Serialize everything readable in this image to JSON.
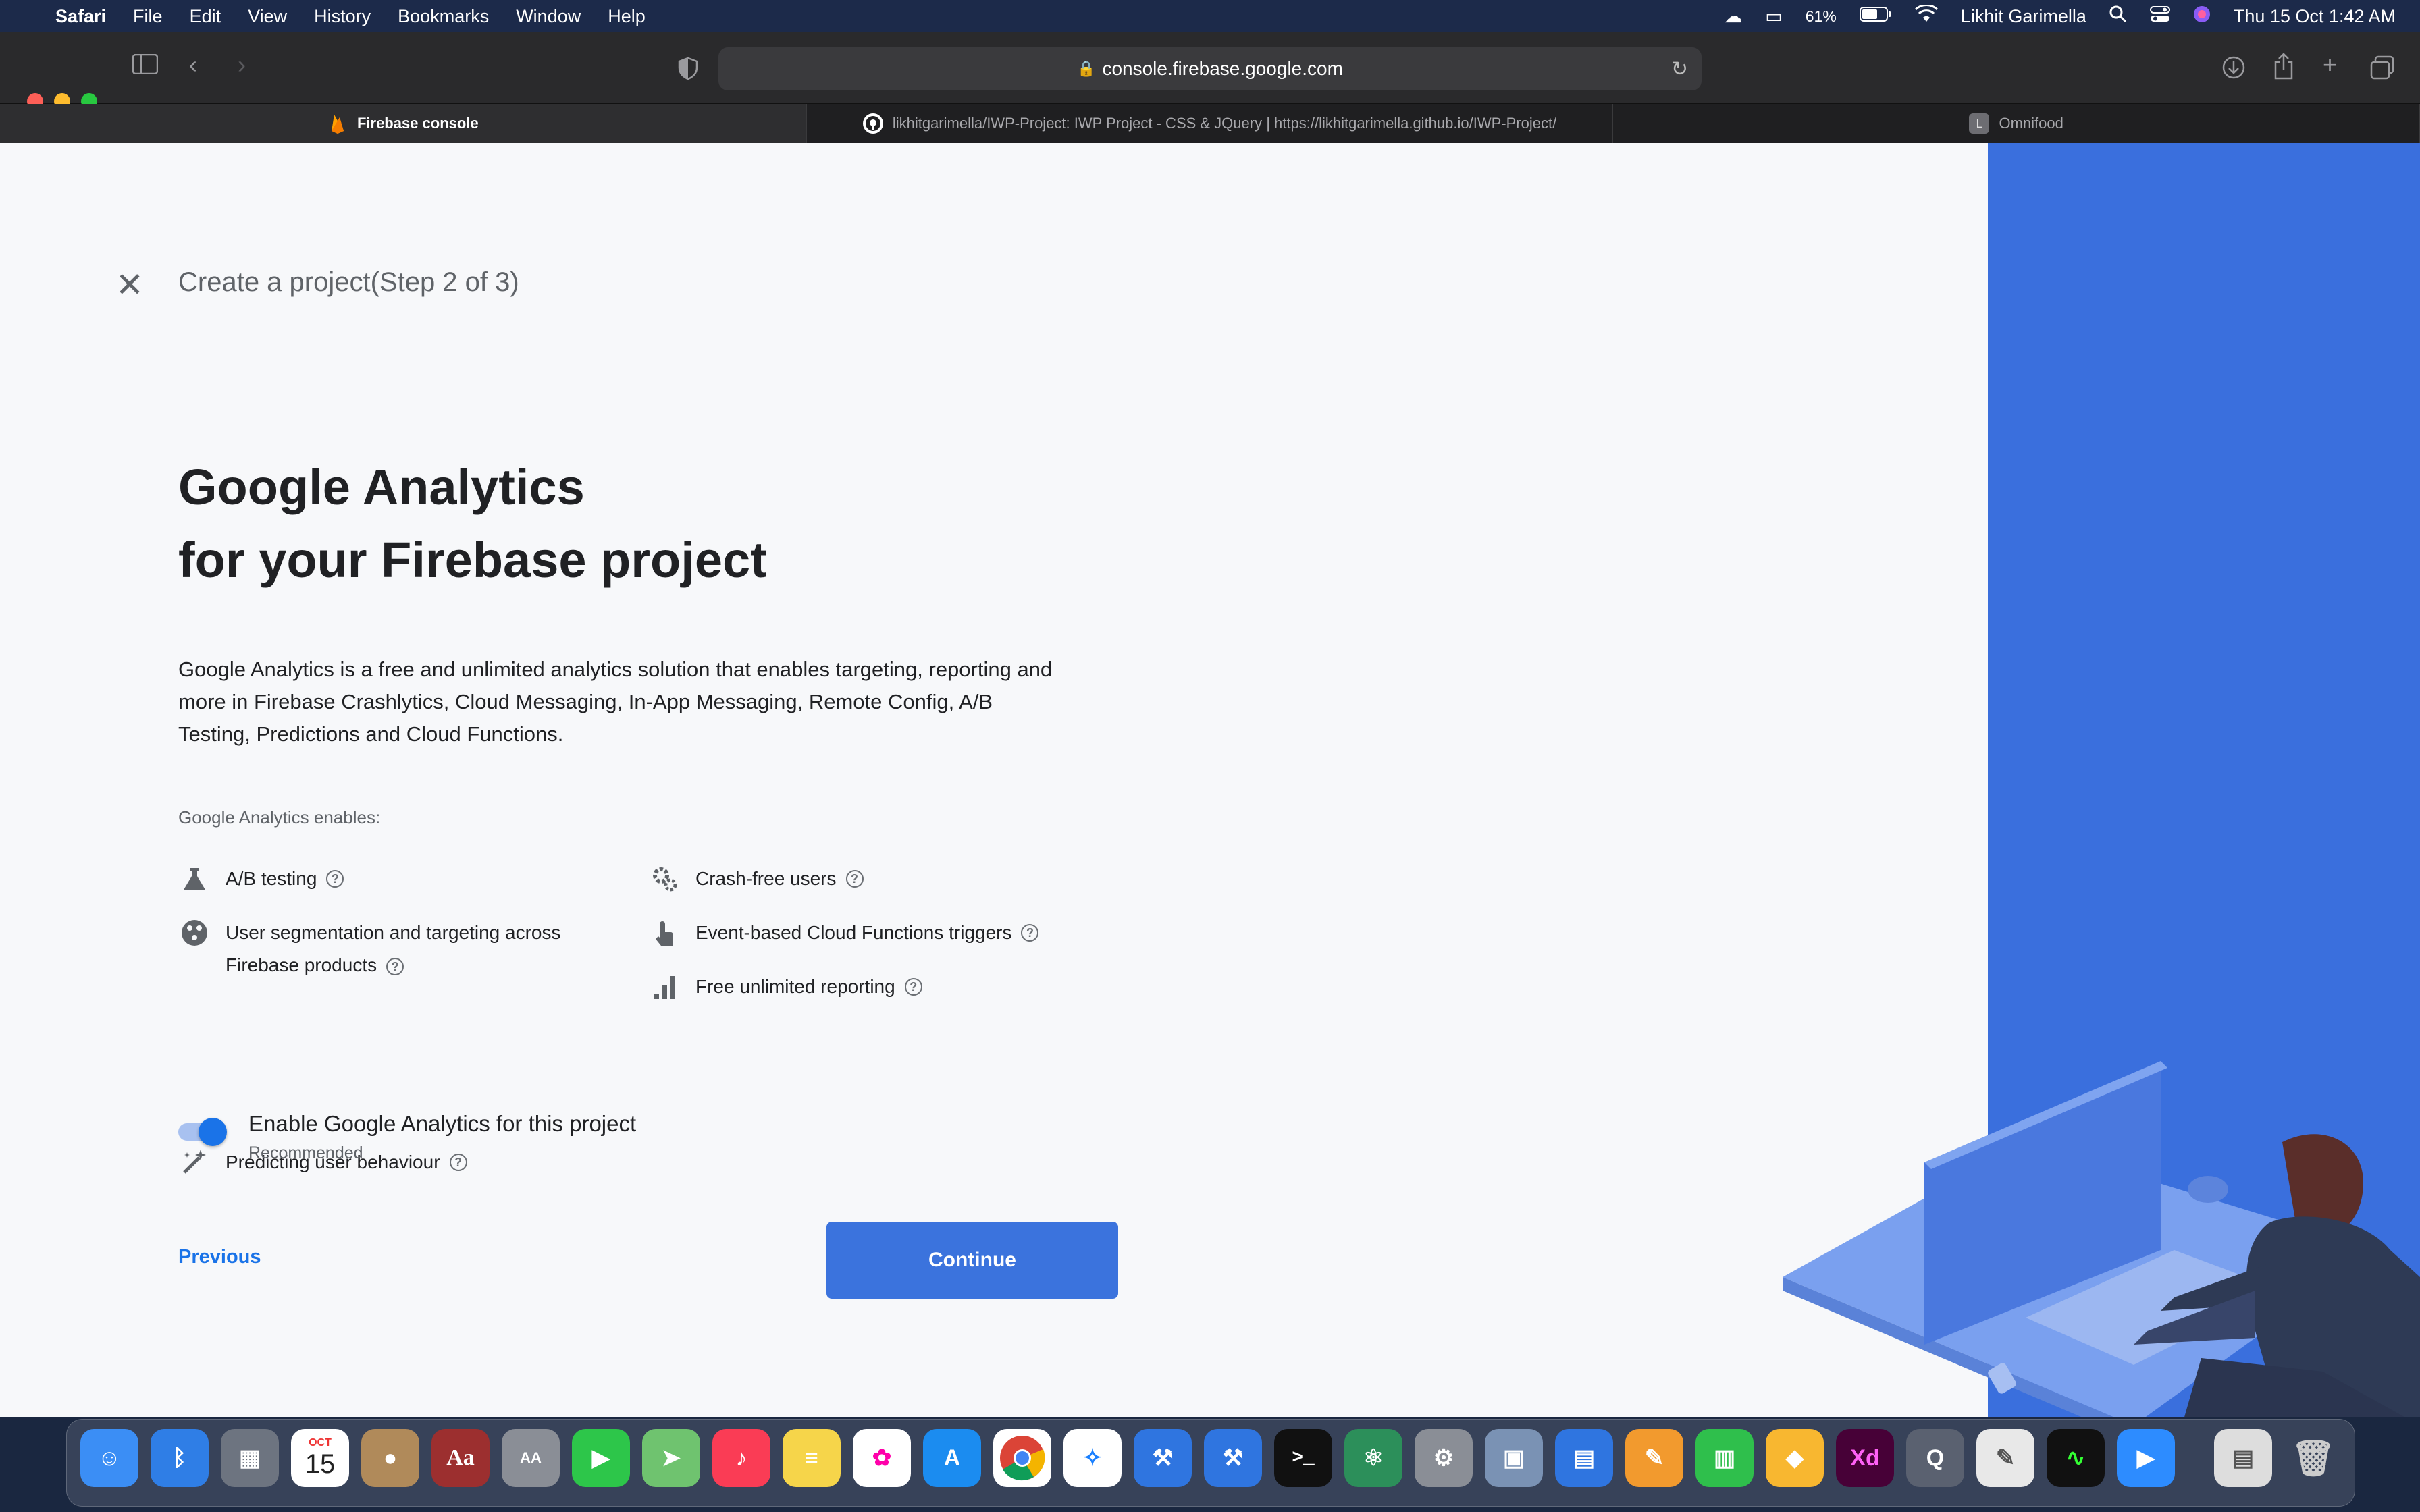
{
  "menubar": {
    "app": "Safari",
    "items": [
      "File",
      "Edit",
      "View",
      "History",
      "Bookmarks",
      "Window",
      "Help"
    ],
    "battery": "61%",
    "user": "Likhit Garimella",
    "datetime": "Thu 15 Oct  1:42 AM"
  },
  "browser": {
    "url": "console.firebase.google.com",
    "tabs": [
      {
        "label": "Firebase console"
      },
      {
        "label": "likhitgarimella/IWP-Project: IWP Project - CSS & JQuery | https://likhitgarimella.github.io/IWP-Project/"
      },
      {
        "label": "Omnifood",
        "favicon_letter": "L"
      }
    ]
  },
  "page": {
    "step_title": "Create a project(Step 2 of 3)",
    "heading_line1": "Google Analytics",
    "heading_line2": "for your Firebase project",
    "description": "Google Analytics is a free and unlimited analytics solution that enables targeting, reporting and more in Firebase Crashlytics, Cloud Messaging, In-App Messaging, Remote Config, A/B Testing, Predictions and Cloud Functions.",
    "enables_label": "Google Analytics enables:",
    "features_left": [
      {
        "icon": "flask-icon",
        "label": "A/B testing"
      },
      {
        "icon": "segmentation-icon",
        "label_line1": "User segmentation and targeting across",
        "label_line2": "Firebase products"
      },
      {
        "icon": "magic-wand-icon",
        "label": "Predicting user behaviour"
      }
    ],
    "features_right": [
      {
        "icon": "gear-icon",
        "label": "Crash-free users"
      },
      {
        "icon": "touch-icon",
        "label": "Event-based Cloud Functions triggers"
      },
      {
        "icon": "bar-chart-icon",
        "label": "Free unlimited reporting"
      }
    ],
    "toggle": {
      "label": "Enable Google Analytics for this project",
      "sublabel": "Recommended",
      "checked": true
    },
    "previous_label": "Previous",
    "continue_label": "Continue",
    "accent_color": "#1a73e8",
    "panel_color": "#3a6fdd"
  },
  "dock": {
    "calendar_month": "OCT",
    "calendar_day": "15"
  }
}
